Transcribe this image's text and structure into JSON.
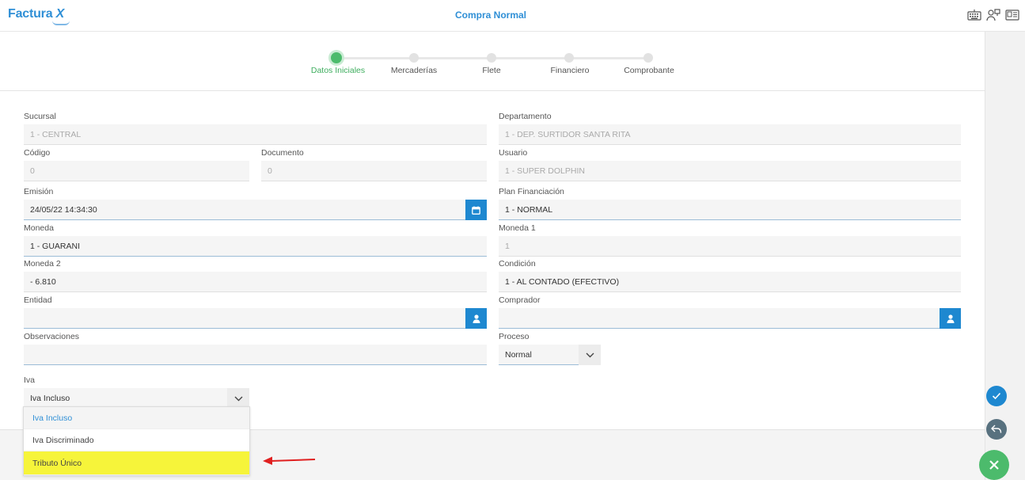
{
  "app": {
    "logo_text": "Factura",
    "logo_mark": "X",
    "title": "Compra Normal"
  },
  "icons": {
    "keyboard": "keyboard-icon",
    "user_network": "user-network-icon",
    "id_card": "id-card-icon"
  },
  "steps": [
    {
      "label": "Datos Iniciales",
      "active": true
    },
    {
      "label": "Mercaderías",
      "active": false
    },
    {
      "label": "Flete",
      "active": false
    },
    {
      "label": "Financiero",
      "active": false
    },
    {
      "label": "Comprobante",
      "active": false
    }
  ],
  "form": {
    "sucursal": {
      "label": "Sucursal",
      "value": "1 - CENTRAL"
    },
    "departamento": {
      "label": "Departamento",
      "value": "1 - DEP. SURTIDOR SANTA RITA"
    },
    "codigo": {
      "label": "Código",
      "value": "0"
    },
    "documento": {
      "label": "Documento",
      "value": "0"
    },
    "usuario": {
      "label": "Usuario",
      "value": "1 - SUPER DOLPHIN"
    },
    "emision": {
      "label": "Emisión",
      "value": "24/05/22 14:34:30"
    },
    "plan_financiacion": {
      "label": "Plan Financiación",
      "value": "1 - NORMAL"
    },
    "moneda": {
      "label": "Moneda",
      "value": "1 - GUARANI"
    },
    "moneda1": {
      "label": "Moneda 1",
      "value": "1"
    },
    "moneda2": {
      "label": "Moneda 2",
      "value": "- 6.810"
    },
    "condicion": {
      "label": "Condición",
      "value": "1 - AL CONTADO (EFECTIVO)"
    },
    "entidad": {
      "label": "Entidad",
      "value": ""
    },
    "comprador": {
      "label": "Comprador",
      "value": ""
    },
    "observaciones": {
      "label": "Observaciones",
      "value": ""
    },
    "proceso": {
      "label": "Proceso",
      "value": "Normal"
    },
    "iva": {
      "label": "Iva",
      "value": "Iva Incluso",
      "options": [
        "Iva Incluso",
        "Iva Discriminado",
        "Tributo Único"
      ],
      "selected_index": 0,
      "highlighted_index": 2
    }
  },
  "colors": {
    "primary": "#1e88d0",
    "brand": "#2f8fd6",
    "success": "#4cbb6c",
    "highlight": "#f6f43a",
    "annotation_arrow": "#e02020"
  }
}
